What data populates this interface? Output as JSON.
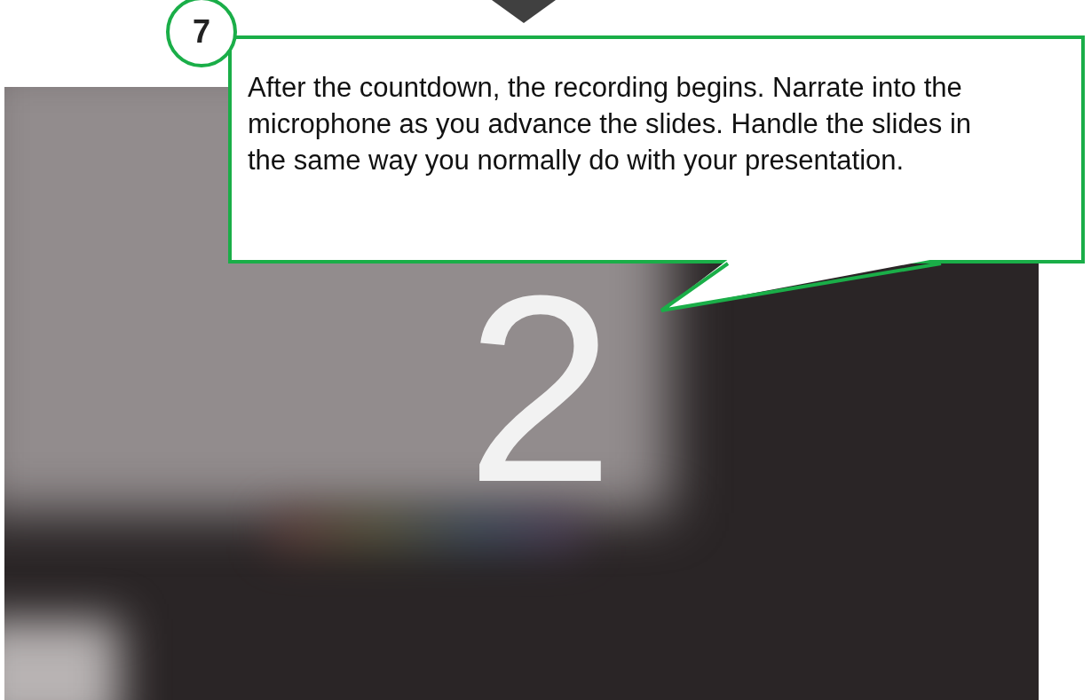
{
  "countdown": {
    "value": "2"
  },
  "step": {
    "number": "7"
  },
  "callout": {
    "text": "After the countdown, the recording begins. Narrate into the microphone as you advance the slides. Handle the slides in the same way you normally do with your presentation."
  }
}
